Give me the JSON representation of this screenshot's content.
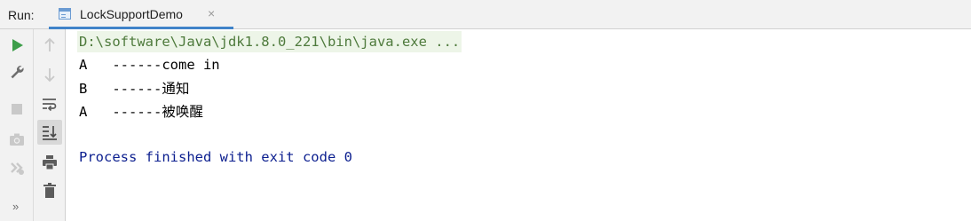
{
  "header": {
    "run_label": "Run:",
    "tab_title": "LockSupportDemo",
    "tab_close": "×"
  },
  "toolbar": {
    "left_icons": [
      "rerun-icon",
      "wrench-icon",
      "stop-icon",
      "camera-icon",
      "exit-icon",
      "more-icon"
    ],
    "right_icons": [
      "up-arrow-icon",
      "down-arrow-icon",
      "soft-wrap-icon",
      "scroll-to-end-icon",
      "print-icon",
      "trash-icon"
    ],
    "more_label": "»"
  },
  "console": {
    "command": "D:\\software\\Java\\jdk1.8.0_221\\bin\\java.exe ...",
    "lines": [
      "A   ------come in",
      "B   ------通知",
      "A   ------被唤醒"
    ],
    "process_exit": "Process finished with exit code 0"
  },
  "colors": {
    "command_text": "#4e7a3c",
    "command_bg": "#edf5e8",
    "process_text": "#0c1f8f",
    "run_green": "#3d9e4a",
    "tab_accent": "#4083c9"
  }
}
